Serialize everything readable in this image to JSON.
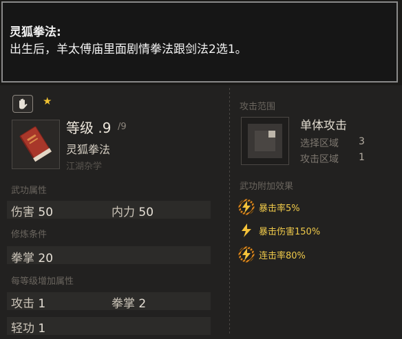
{
  "tooltip": {
    "title": "灵狐拳法:",
    "body": "出生后，羊太傅庙里面剧情拳法跟剑法2选1。"
  },
  "skill": {
    "level_label": "等级",
    "level": ".9",
    "level_max": "/9",
    "name": "灵狐拳法",
    "category": "江湖杂学"
  },
  "sections": {
    "attributes": "武功属性",
    "requirements": "修炼条件",
    "per_level": "每等级增加属性",
    "attack_range": "攻击范围",
    "extra_effects": "武功附加效果"
  },
  "attributes": [
    {
      "label": "伤害",
      "value": "50"
    },
    {
      "label": "内力",
      "value": "50"
    }
  ],
  "requirements": [
    {
      "label": "拳掌",
      "value": "20"
    }
  ],
  "per_level": [
    {
      "label": "攻击",
      "value": "1"
    },
    {
      "label": "拳掌",
      "value": "2"
    },
    {
      "label": "轻功",
      "value": "1"
    }
  ],
  "attack": {
    "type": "单体攻击",
    "select_area_label": "选择区域",
    "select_area_value": "3",
    "attack_area_label": "攻击区域",
    "attack_area_value": "1"
  },
  "effects": [
    {
      "icon": "striped-lightning-icon",
      "text": "暴击率5%"
    },
    {
      "icon": "lightning-bolt-icon",
      "text": "暴击伤害150%"
    },
    {
      "icon": "striped-lightning-icon",
      "text": "连击率80%"
    }
  ],
  "icons": {
    "skill_type": "open-hand-icon",
    "rarity": "star-icon",
    "book": "red-book-icon"
  },
  "colors": {
    "effect_text": "#f0ca4a",
    "star": "#f1c232",
    "book": "#a8372a"
  }
}
